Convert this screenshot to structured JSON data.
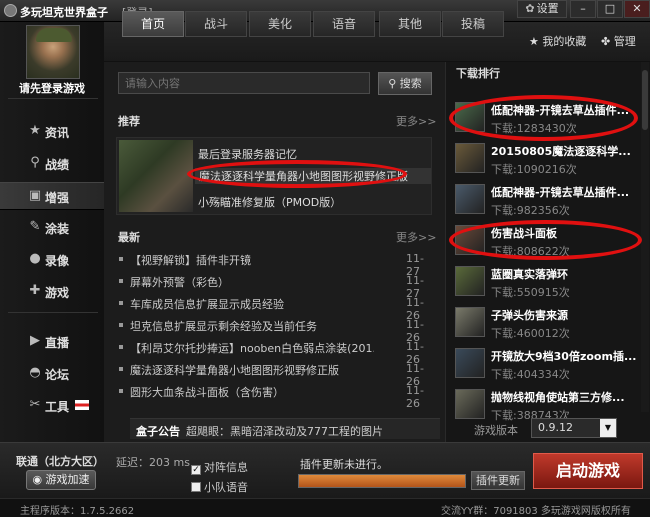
{
  "app": {
    "title": "多玩坦克世界盒子",
    "login_tag": "[登录]",
    "settings_label": "设置",
    "min_label": "–",
    "max_label": "□",
    "close_label": "✕"
  },
  "sidebar": {
    "login_prompt": "请先登录游戏",
    "items": [
      {
        "label": "资讯",
        "icon": "star-icon",
        "glyph": "★"
      },
      {
        "label": "战绩",
        "icon": "search-icon",
        "glyph": "⚲"
      },
      {
        "label": "增强",
        "icon": "toolbox-icon",
        "glyph": "▣"
      },
      {
        "label": "涂装",
        "icon": "paint-icon",
        "glyph": "✎"
      },
      {
        "label": "录像",
        "icon": "camera-icon",
        "glyph": "●"
      },
      {
        "label": "游戏",
        "icon": "gamepad-icon",
        "glyph": "✚"
      },
      {
        "label": "直播",
        "icon": "play-icon",
        "glyph": "▶"
      },
      {
        "label": "论坛",
        "icon": "chat-icon",
        "glyph": "◓"
      },
      {
        "label": "工具",
        "icon": "tools-icon",
        "glyph": "✂"
      }
    ]
  },
  "tabs": [
    "首页",
    "战斗",
    "美化",
    "语音",
    "其他",
    "投稿"
  ],
  "header": {
    "favorites_label": "我的收藏",
    "manage_label": "管理"
  },
  "search": {
    "placeholder": "请输入内容",
    "button_label": "搜索"
  },
  "recommend": {
    "title": "推荐",
    "more": "更多>>",
    "items": [
      "最后登录服务器记忆",
      "魔法逐逐科学量角器小地图图形视野修正版",
      "小殇瞄准修复版（PMOD版）"
    ]
  },
  "latest": {
    "title": "最新",
    "more": "更多>>",
    "items": [
      {
        "title": "【视野解锁】插件非开镜",
        "date": "11-27"
      },
      {
        "title": "屏幕外预警（彩色）",
        "date": "11-27"
      },
      {
        "title": "车库成员信息扩展显示成员经验",
        "date": "11-26"
      },
      {
        "title": "坦克信息扩展显示剩余经验及当前任务",
        "date": "11-26"
      },
      {
        "title": "【利昂艾尔托抄捧运】nooben白色弱点涂装(201...",
        "date": "11-26"
      },
      {
        "title": "魔法逐逐科学量角器小地图图形视野修正版",
        "date": "11-26"
      },
      {
        "title": "圆形大血条战斗面板（含伤害）",
        "date": "11-26"
      }
    ]
  },
  "notice": {
    "label": "盒子公告",
    "text": "超飓眼：黑暗沼泽改动及777工程的图片"
  },
  "downloads": {
    "title": "下载排行",
    "items": [
      {
        "name": "低配神器-开镜去草丛插件...",
        "count": "下载:1283430次"
      },
      {
        "name": "20150805魔法逐逐科学...",
        "count": "下载:1090216次"
      },
      {
        "name": "低配神器-开镜去草丛插件...",
        "count": "下载:982356次"
      },
      {
        "name": "伤害战斗面板",
        "count": "下载:808622次"
      },
      {
        "name": "蓝圈真实落弹环",
        "count": "下载:550915次"
      },
      {
        "name": "子弹头伤害来源",
        "count": "下载:460012次"
      },
      {
        "name": "开镜放大9档30倍zoom插...",
        "count": "下载:404334次"
      },
      {
        "name": "抛物线视角使站第三方修...",
        "count": "下载:388743次"
      }
    ]
  },
  "version": {
    "label": "游戏版本",
    "value": "0.9.12"
  },
  "bottom": {
    "network": "联通（北方大区）",
    "latency": "延迟：203 ms",
    "accelerate": "游戏加速",
    "chk_team": "对阵信息",
    "chk_team_checked": true,
    "chk_voice": "小队语音",
    "chk_voice_checked": false,
    "update_text": "插件更新未进行。",
    "update_btn": "插件更新",
    "progress": 1.0,
    "start_btn": "启动游戏"
  },
  "status": {
    "left": "主程序版本：1.7.5.2662",
    "right": "交流YY群：7091803 多玩游戏网版权所有"
  }
}
